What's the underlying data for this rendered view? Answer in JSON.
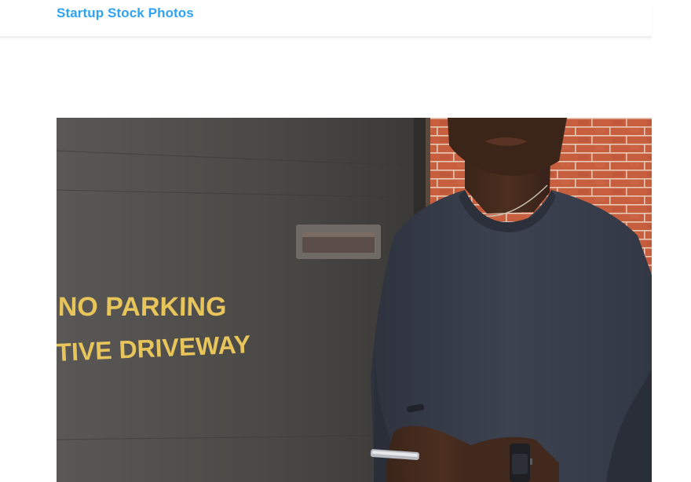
{
  "header": {
    "site_title": "Startup Stock Photos"
  },
  "hero": {
    "sign_line_1": "NO PARKING",
    "sign_line_2": "TIVE DRIVEWAY",
    "description": ""
  },
  "colors": {
    "brand": "#2ea3f2",
    "sign_text": "#e8c55a",
    "door": "#4a4845",
    "brick": "#c4593a",
    "shirt": "#3a3f4b"
  },
  "icons": {
    "watch": "smartwatch-icon",
    "phone": "smartphone-icon"
  }
}
